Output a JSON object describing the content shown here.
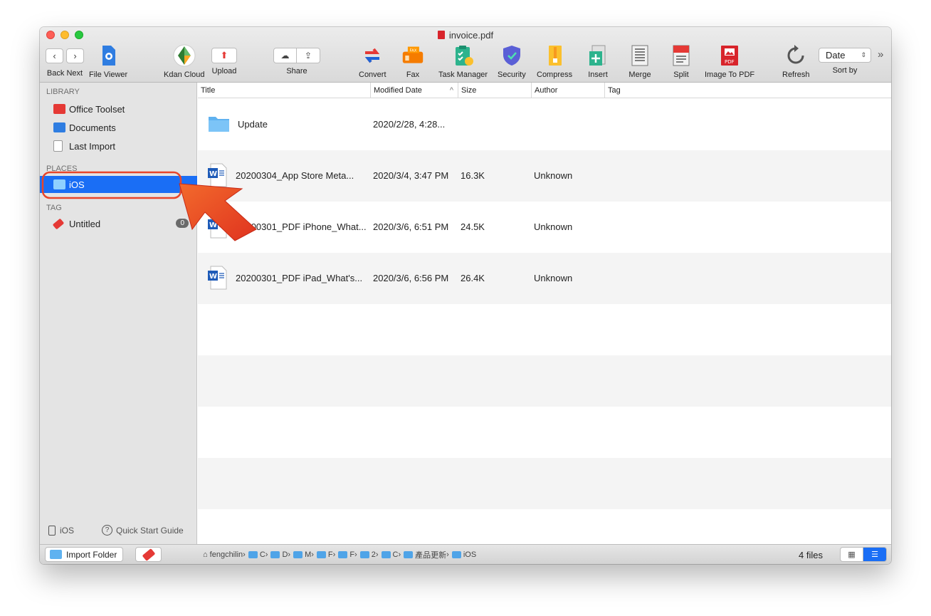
{
  "window": {
    "title": "invoice.pdf"
  },
  "toolbar": {
    "back_label": "Back",
    "next_label": "Next",
    "file_viewer_label": "File Viewer",
    "kdan_cloud_label": "Kdan Cloud",
    "upload_label": "Upload",
    "share_label": "Share",
    "convert_label": "Convert",
    "fax_label": "Fax",
    "task_manager_label": "Task Manager",
    "security_label": "Security",
    "compress_label": "Compress",
    "insert_label": "Insert",
    "merge_label": "Merge",
    "split_label": "Split",
    "image_to_pdf_label": "Image To PDF",
    "refresh_label": "Refresh",
    "sort_by_label": "Sort by",
    "sort_value": "Date",
    "overflow_label": "»",
    "fax_icon_text": "FAX",
    "pdf_icon_text": "PDF"
  },
  "sidebar": {
    "library_header": "LIBRARY",
    "library_items": [
      {
        "label": "Office Toolset"
      },
      {
        "label": "Documents"
      },
      {
        "label": "Last Import"
      }
    ],
    "places_header": "PLACES",
    "places_items": [
      {
        "label": "iOS"
      }
    ],
    "tag_header": "TAG",
    "tag_items": [
      {
        "label": "Untitled",
        "count": "0"
      }
    ],
    "bottom_ios_label": "iOS",
    "quick_start_label": "Quick Start Guide"
  },
  "columns": {
    "title": "Title",
    "modified": "Modified Date",
    "size": "Size",
    "author": "Author",
    "tag": "Tag"
  },
  "files": [
    {
      "type": "folder",
      "title": "Update",
      "modified": "2020/2/28, 4:28...",
      "size": "",
      "author": ""
    },
    {
      "type": "word",
      "title": "20200304_App Store Meta...",
      "modified": "2020/3/4, 3:47 PM",
      "size": "16.3K",
      "author": "Unknown"
    },
    {
      "type": "word",
      "title": "20200301_PDF iPhone_What...",
      "modified": "2020/3/6, 6:51 PM",
      "size": "24.5K",
      "author": "Unknown"
    },
    {
      "type": "word",
      "title": "20200301_PDF iPad_What's...",
      "modified": "2020/3/6, 6:56 PM",
      "size": "26.4K",
      "author": "Unknown"
    }
  ],
  "status": {
    "import_folder_label": "Import Folder",
    "breadcrumb": [
      "fengchilin",
      "C",
      "D",
      "M",
      "F",
      "F",
      "2",
      "C",
      "產品更新",
      "iOS"
    ],
    "file_count": "4 files"
  },
  "colors": {
    "accent": "#1a6ef5",
    "annotation": "#e8452a"
  }
}
